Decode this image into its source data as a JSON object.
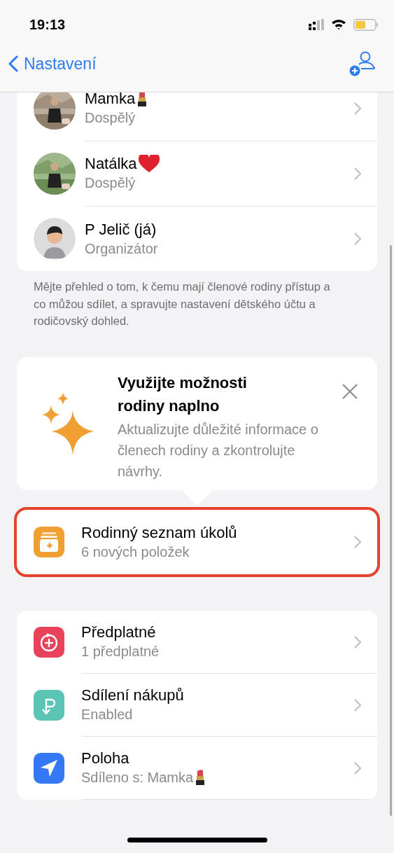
{
  "status_bar": {
    "time": "19:13"
  },
  "nav": {
    "back": "Nastavení"
  },
  "members": [
    {
      "name": "Mamka",
      "badge": {
        "kind": "lipstick"
      },
      "role": "Dospělý"
    },
    {
      "name": "Natálka",
      "badge": {
        "kind": "heart"
      },
      "role": "Dospělý"
    },
    {
      "kind": "memoji",
      "name": "P Jelič (já)",
      "role": "Organizátor"
    }
  ],
  "members_footer": "Mějte přehled o tom, k čemu mají členové rodiny přístup a co můžou sdílet, a spravujte nastavení dětského účtu a rodičovský dohled.",
  "promo": {
    "title": "Využijte možnosti rodiny naplno",
    "body": "Aktualizujte důležité informace o členech rodiny a zkontrolujte návrhy."
  },
  "checklist": {
    "title": "Rodinný seznam úkolů",
    "subtitle": "6 nových položek",
    "highlighted": true,
    "color": "#f0a033"
  },
  "services": [
    {
      "kind": "subscriptions",
      "title": "Předplatné",
      "subtitle": "1 předplatné",
      "color": "#e8435a"
    },
    {
      "kind": "purchase_sharing",
      "title": "Sdílení nákupů",
      "subtitle": "Enabled",
      "color": "#5bc4b5"
    },
    {
      "kind": "location",
      "title": "Poloha",
      "subtitle": "Sdíleno s: Mamka",
      "badge": {
        "kind": "lipstick"
      },
      "color": "#3478f6"
    }
  ]
}
